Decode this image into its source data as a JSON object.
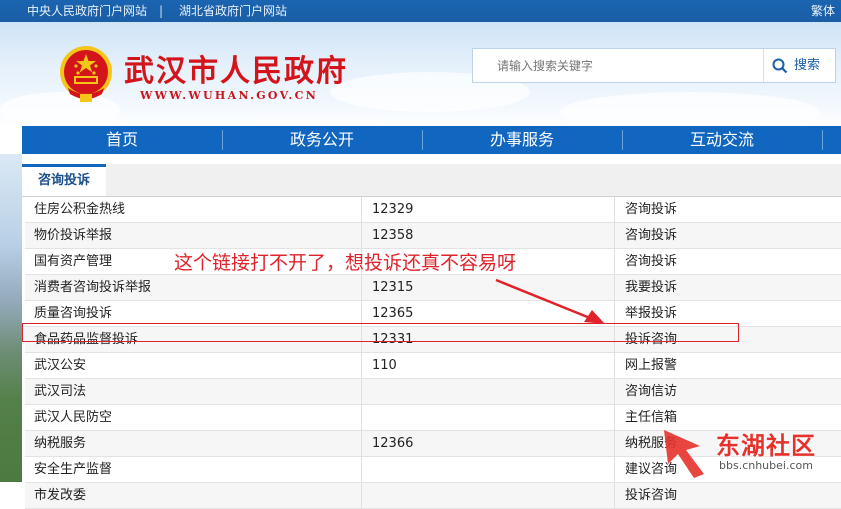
{
  "topbar": {
    "link_central": "中央人民政府门户网站",
    "separator": "|",
    "link_hubei": "湖北省政府门户网站",
    "traditional": "繁体"
  },
  "header": {
    "title": "武汉市人民政府",
    "url": "WWW.WUHAN.GOV.CN",
    "search_placeholder": "请输入搜索关键字",
    "search_button": "搜索"
  },
  "nav": [
    "首页",
    "政务公开",
    "办事服务",
    "互动交流"
  ],
  "tab": {
    "label": "咨询投诉"
  },
  "rows": [
    {
      "name": "住房公积金热线",
      "phone": "12329",
      "action": "咨询投诉"
    },
    {
      "name": "物价投诉举报",
      "phone": "12358",
      "action": "咨询投诉"
    },
    {
      "name": "国有资产管理",
      "phone": "",
      "action": "咨询投诉"
    },
    {
      "name": "消费者咨询投诉举报",
      "phone": "12315",
      "action": "我要投诉"
    },
    {
      "name": "质量咨询投诉",
      "phone": "12365",
      "action": "举报投诉"
    },
    {
      "name": "食品药品监督投诉",
      "phone": "12331",
      "action": "投诉咨询"
    },
    {
      "name": "武汉公安",
      "phone": "110",
      "action": "网上报警"
    },
    {
      "name": "武汉司法",
      "phone": "",
      "action": "咨询信访"
    },
    {
      "name": "武汉人民防空",
      "phone": "",
      "action": "主任信箱"
    },
    {
      "name": "纳税服务",
      "phone": "12366",
      "action": "纳税服务"
    },
    {
      "name": "安全生产监督",
      "phone": "",
      "action": "建议咨询"
    },
    {
      "name": "市发改委",
      "phone": "",
      "action": "投诉咨询"
    }
  ],
  "annotation": "这个链接打不开了，想投诉还真不容易呀",
  "watermark": {
    "brand": "东湖社区",
    "url": "bbs.cnhubei.com"
  },
  "colors": {
    "nav_blue": "#1167c0",
    "title_red": "#d4141b",
    "annotation_red": "#e0232b"
  }
}
